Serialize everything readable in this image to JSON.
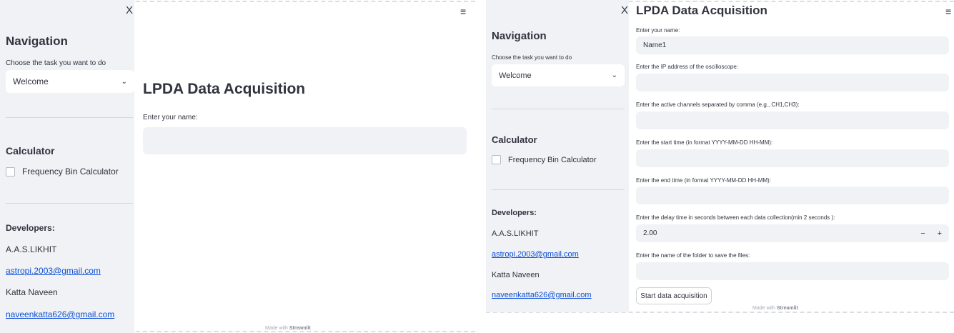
{
  "left": {
    "sidebar": {
      "close": "X",
      "navigation_title": "Navigation",
      "choose_label": "Choose the task you want to do",
      "select_value": "Welcome",
      "calculator_title": "Calculator",
      "checkbox_label": "Frequency Bin Calculator",
      "developers_label": "Developers:",
      "dev1_name": "A.A.S.LIKHIT",
      "dev1_email": "astropi.2003@gmail.com",
      "dev2_name": "Katta Naveen",
      "dev2_email": "naveenkatta626@gmail.com"
    },
    "main": {
      "menu": "≡",
      "title": "LPDA Data Acquisition",
      "name_label": "Enter your name:",
      "name_value": ""
    },
    "footer": {
      "prefix": "Made with",
      "brand": "Streamlit"
    }
  },
  "right": {
    "sidebar": {
      "close": "X",
      "navigation_title": "Navigation",
      "choose_label": "Choose the task you want to do",
      "select_value": "Welcome",
      "calculator_title": "Calculator",
      "checkbox_label": "Frequency Bin Calculator",
      "developers_label": "Developers:",
      "dev1_name": "A.A.S.LIKHIT",
      "dev1_email": "astropi.2003@gmail.com",
      "dev2_name": "Katta Naveen",
      "dev2_email": "naveenkatta626@gmail.com"
    },
    "main": {
      "menu": "≡",
      "title": "LPDA Data Acquisition",
      "fields": {
        "name_label": "Enter your name:",
        "name_value": "Name1",
        "ip_label": "Enter the IP address of the oscilloscope:",
        "ip_value": "",
        "channels_label": "Enter the active channels separated by comma (e.g., CH1,CH3):",
        "channels_value": "",
        "start_label": "Enter the start time (in format YYYY-MM-DD HH-MM):",
        "start_value": "",
        "end_label": "Enter the end time (in format YYYY-MM-DD HH-MM):",
        "end_value": "",
        "delay_label": "Enter the delay time in seconds between each data collection(min 2 seconds ):",
        "delay_value": "2.00",
        "minus": "−",
        "plus": "+",
        "folder_label": "Enter the name of the folder to save the files:",
        "folder_value": ""
      },
      "start_button": "Start data acquisition"
    },
    "footer": {
      "prefix": "Made with",
      "brand": "Streamlit"
    }
  }
}
